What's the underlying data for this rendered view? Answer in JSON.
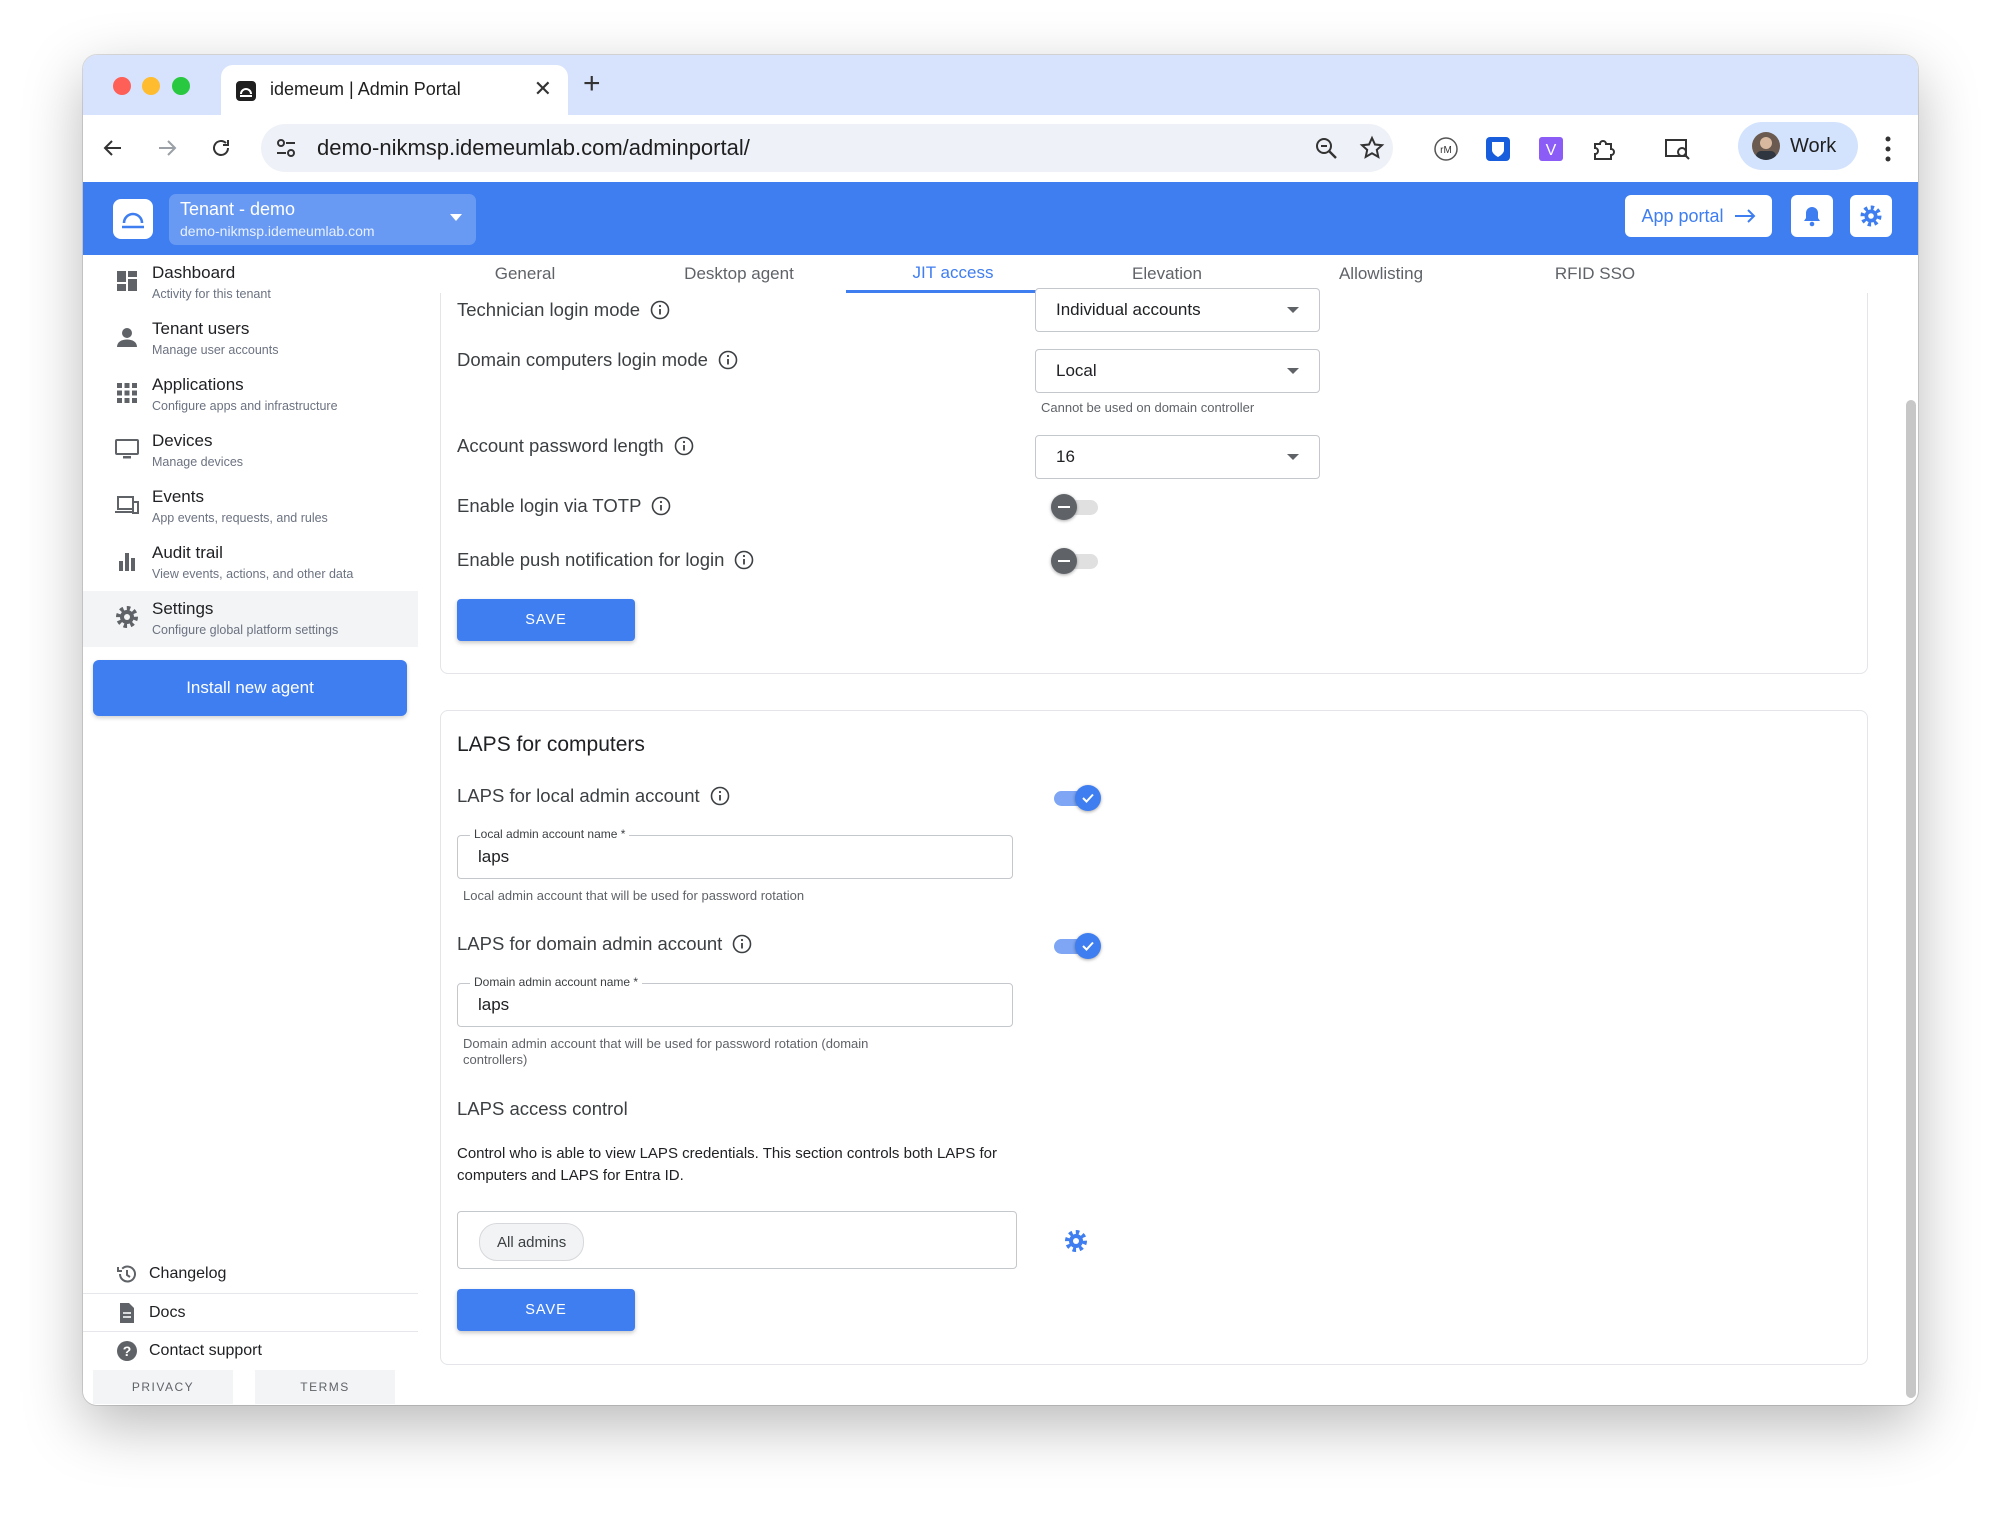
{
  "browser": {
    "tab_title": "idemeum | Admin Portal",
    "url": "demo-nikmsp.idemeumlab.com/adminportal/",
    "profile_label": "Work"
  },
  "header": {
    "tenant_name": "Tenant - demo",
    "tenant_domain": "demo-nikmsp.idemeumlab.com",
    "app_portal_label": "App portal",
    "accent_color": "#3f7ef0"
  },
  "sidebar": {
    "items": [
      {
        "label": "Dashboard",
        "sub": "Activity for this tenant",
        "icon": "dashboard-icon"
      },
      {
        "label": "Tenant users",
        "sub": "Manage user accounts",
        "icon": "person-icon"
      },
      {
        "label": "Applications",
        "sub": "Configure apps and infrastructure",
        "icon": "apps-grid-icon"
      },
      {
        "label": "Devices",
        "sub": "Manage devices",
        "icon": "monitor-icon"
      },
      {
        "label": "Events",
        "sub": "App events, requests, and rules",
        "icon": "devices-icon"
      },
      {
        "label": "Audit trail",
        "sub": "View events, actions, and other data",
        "icon": "bar-chart-icon"
      },
      {
        "label": "Settings",
        "sub": "Configure global platform settings",
        "icon": "gear-icon"
      }
    ],
    "install_label": "Install new agent",
    "footer": [
      {
        "label": "Changelog",
        "icon": "history-icon"
      },
      {
        "label": "Docs",
        "icon": "document-icon"
      },
      {
        "label": "Contact support",
        "icon": "help-icon"
      }
    ],
    "privacy_label": "PRIVACY",
    "terms_label": "TERMS"
  },
  "tabs": [
    "General",
    "Desktop agent",
    "JIT access",
    "Elevation",
    "Allowlisting",
    "RFID SSO"
  ],
  "active_tab": "JIT access",
  "jit": {
    "technician_login_label": "Technician login mode",
    "technician_login_value": "Individual accounts",
    "domain_login_label": "Domain computers login mode",
    "domain_login_value": "Local",
    "domain_login_helper": "Cannot be used on domain controller",
    "password_length_label": "Account password length",
    "password_length_value": "16",
    "totp_label": "Enable login via TOTP",
    "totp_enabled": false,
    "push_label": "Enable push notification for login",
    "push_enabled": false,
    "save_label": "SAVE"
  },
  "laps": {
    "title": "LAPS for computers",
    "local_label": "LAPS for local admin account",
    "local_enabled": true,
    "local_field_label": "Local admin account name *",
    "local_field_value": "laps",
    "local_helper": "Local admin account that will be used for password rotation",
    "domain_label": "LAPS for domain admin account",
    "domain_enabled": true,
    "domain_field_label": "Domain admin account name *",
    "domain_field_value": "laps",
    "domain_helper_1": "Domain admin account that will be used for password rotation (domain",
    "domain_helper_2": "controllers)",
    "access_title": "LAPS access control",
    "access_desc_1": "Control who is able to view LAPS credentials. This section controls both LAPS for",
    "access_desc_2": "computers and LAPS for Entra ID.",
    "access_chip": "All admins",
    "save_label": "SAVE"
  }
}
